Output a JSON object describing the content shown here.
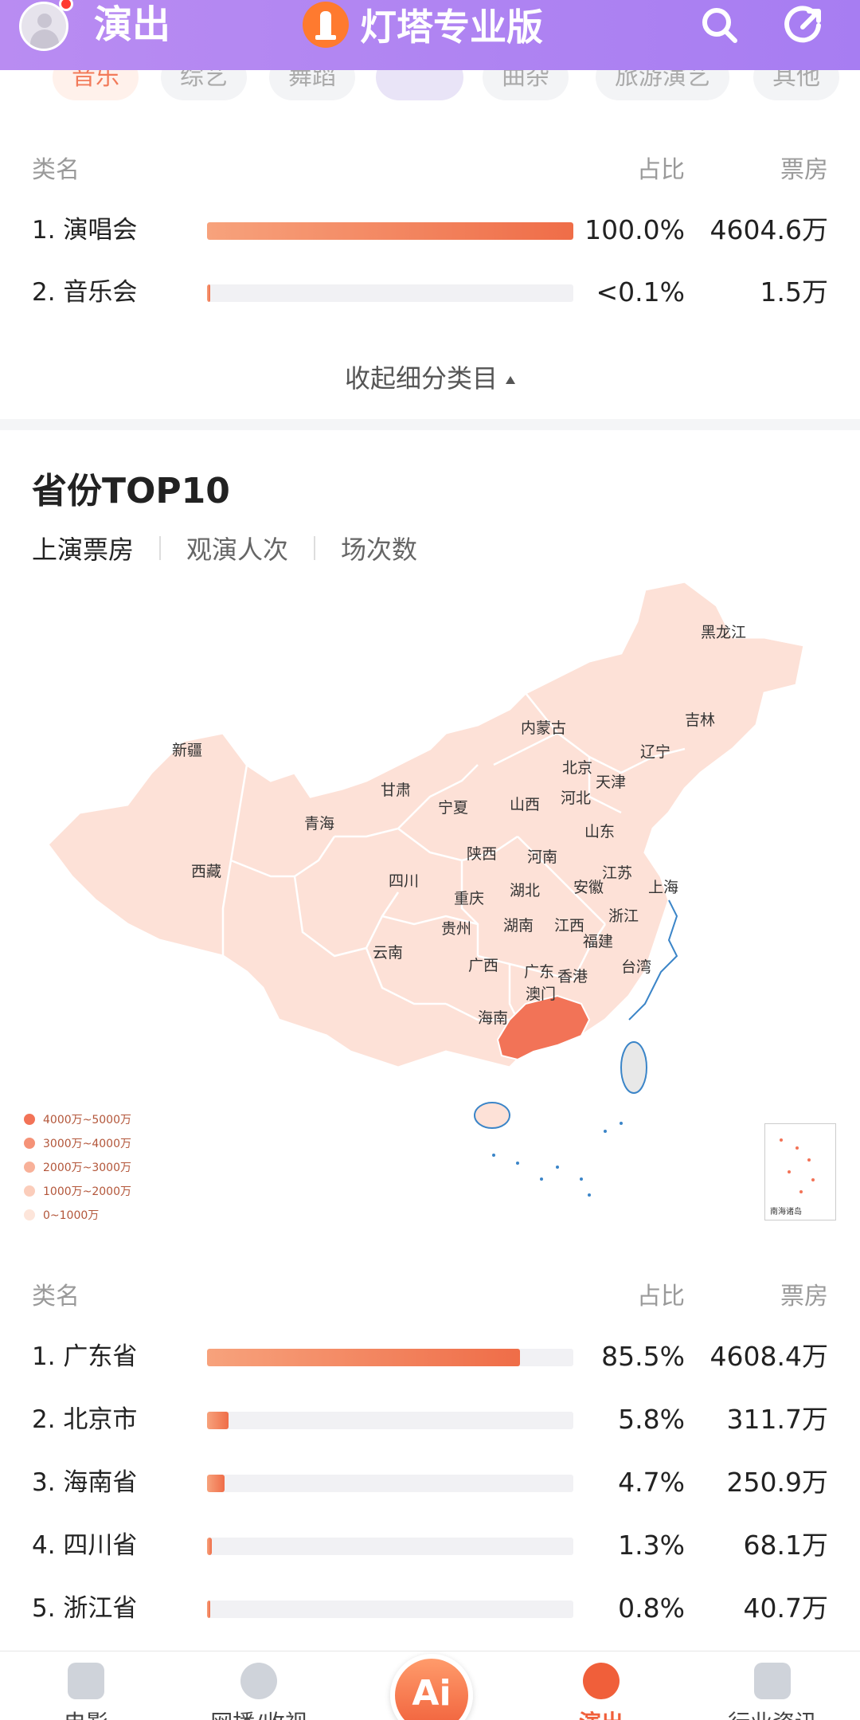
{
  "header": {
    "title": "演出",
    "brand": "灯塔专业版",
    "icons": [
      "user-avatar",
      "search-icon",
      "share-icon"
    ]
  },
  "chips": [
    "音乐",
    "综艺",
    "舞蹈",
    "曲杂",
    "旅游演艺",
    "其他"
  ],
  "active_chip": 0,
  "subcategory_table": {
    "columns": [
      "类名",
      "占比",
      "票房"
    ],
    "rows": [
      {
        "name": "1. 演唱会",
        "share": "100.0%",
        "box": "4604.6万",
        "fill": 1.0
      },
      {
        "name": "2. 音乐会",
        "share": "<0.1%",
        "box": "1.5万",
        "fill": 0.001
      }
    ],
    "collapse_label": "收起细分类目"
  },
  "province_section": {
    "title": "省份TOP10",
    "tabs": [
      "上演票房",
      "观演人次",
      "场次数"
    ],
    "active_tab": 0,
    "map_labels": [
      "黑龙江",
      "吉林",
      "辽宁",
      "内蒙古",
      "新疆",
      "北京",
      "天津",
      "河北",
      "甘肃",
      "宁夏",
      "山西",
      "山东",
      "青海",
      "陕西",
      "河南",
      "江苏",
      "西藏",
      "四川",
      "安徽",
      "上海",
      "湖北",
      "重庆",
      "浙江",
      "贵州",
      "湖南",
      "江西",
      "云南",
      "福建",
      "广西",
      "广东",
      "香港",
      "台湾",
      "澳门",
      "海南"
    ],
    "legend": [
      "4000万~5000万",
      "3000万~4000万",
      "2000万~3000万",
      "1000万~2000万",
      "0~1000万"
    ],
    "legend_colors": [
      "#f27357",
      "#f59277",
      "#f8b199",
      "#fbcdbb",
      "#fde5da"
    ],
    "mini_map_label": "南海诸岛",
    "highlight_province": "广东",
    "highlight_color": "#f27357",
    "base_color": "#fde1d7",
    "coast_color": "#3b85c8"
  },
  "province_table": {
    "columns": [
      "类名",
      "占比",
      "票房"
    ],
    "rows": [
      {
        "name": "1. 广东省",
        "share": "85.5%",
        "box": "4608.4万",
        "fill": 0.855
      },
      {
        "name": "2. 北京市",
        "share": "5.8%",
        "box": "311.7万",
        "fill": 0.058
      },
      {
        "name": "3. 海南省",
        "share": "4.7%",
        "box": "250.9万",
        "fill": 0.047
      },
      {
        "name": "4. 四川省",
        "share": "1.3%",
        "box": "68.1万",
        "fill": 0.013
      },
      {
        "name": "5. 浙江省",
        "share": "0.8%",
        "box": "40.7万",
        "fill": 0.008
      }
    ]
  },
  "tabbar": {
    "items": [
      "电影",
      "网播/收视",
      "",
      "演出",
      "行业资讯"
    ],
    "active_index": 3,
    "center_label": "Ai"
  },
  "accent_color": "#f05f3a",
  "header_color": "#a77df2"
}
